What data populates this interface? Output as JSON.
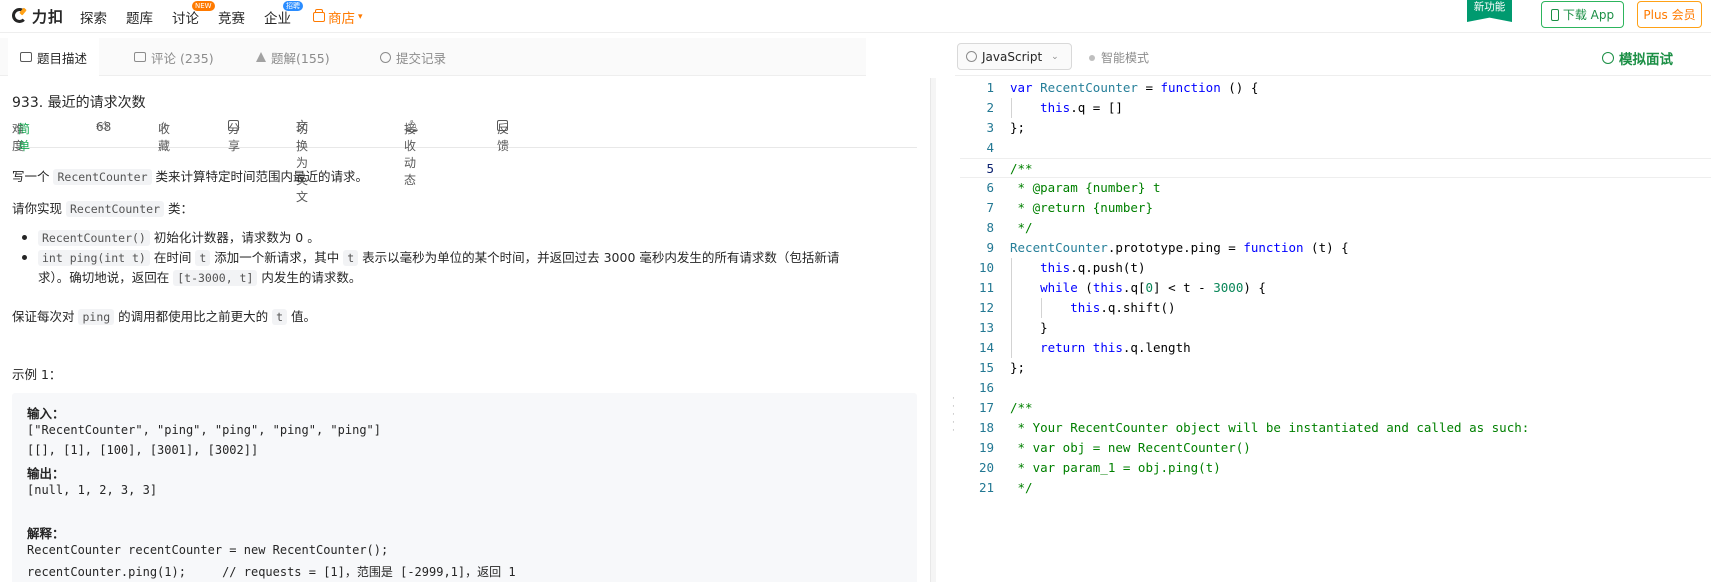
{
  "nav": {
    "logo": "力扣",
    "items": [
      "探索",
      "题库",
      "讨论",
      "竞赛",
      "企业"
    ],
    "badge_new": "NEW",
    "badge_hire": "招聘",
    "shop": "商店",
    "new_feature": "新功能",
    "download_app": "下载 App",
    "plus": "Plus 会员"
  },
  "tabs": {
    "description": "题目描述",
    "comments": "评论 (235)",
    "solutions": "题解(155)",
    "submissions": "提交记录"
  },
  "problem": {
    "title": "933. 最近的请求次数",
    "difficulty_label": "难度",
    "difficulty": "简单",
    "likes": "68",
    "favorite": "收藏",
    "share": "分享",
    "switch_en": "切换为英文",
    "subscribe": "接收动态",
    "feedback": "反馈",
    "p1_a": "写一个 ",
    "p1_code": "RecentCounter",
    "p1_b": " 类来计算特定时间范围内最近的请求。",
    "p2_a": "请你实现 ",
    "p2_code": "RecentCounter",
    "p2_b": " 类：",
    "b1_code": "RecentCounter()",
    "b1_text": " 初始化计数器，请求数为 0 。",
    "b2_code1": "int ping(int t)",
    "b2_t1": " 在时间 ",
    "b2_code2": "t",
    "b2_t2": " 添加一个新请求，其中 ",
    "b2_code3": "t",
    "b2_t3": " 表示以毫秒为单位的某个时间，并返回过去 3000 毫秒内发生的所有请求数（包括新请",
    "b2_t4": "求）。确切地说，返回在 ",
    "b2_code4": "[t-3000, t]",
    "b2_t5": " 内发生的请求数。",
    "p3_a": "保证每次对 ",
    "p3_code1": "ping",
    "p3_b": " 的调用都使用比之前更大的 ",
    "p3_code2": "t",
    "p3_c": " 值。",
    "example_title": "示例 1：",
    "ex_input_label": "输入：",
    "ex_input_1": "[\"RecentCounter\", \"ping\", \"ping\", \"ping\", \"ping\"]",
    "ex_input_2": "[[], [1], [100], [3001], [3002]]",
    "ex_output_label": "输出：",
    "ex_output": "[null, 1, 2, 3, 3]",
    "ex_explain_label": "解释：",
    "ex_explain_1": "RecentCounter recentCounter = new RecentCounter();",
    "ex_explain_2": "recentCounter.ping(1);     // requests = [1]，范围是 [-2999,1]，返回 1"
  },
  "editor": {
    "language": "JavaScript",
    "smart_mode": "智能模式",
    "mock_interview": "模拟面试",
    "line_numbers": [
      "1",
      "2",
      "3",
      "4",
      "5",
      "6",
      "7",
      "8",
      "9",
      "10",
      "11",
      "12",
      "13",
      "14",
      "15",
      "16",
      "17",
      "18",
      "19",
      "20",
      "21"
    ]
  },
  "colors": {
    "accent_green": "#1b8f45",
    "shop_orange": "#ff7a00",
    "easy_green": "#1aaa55"
  }
}
